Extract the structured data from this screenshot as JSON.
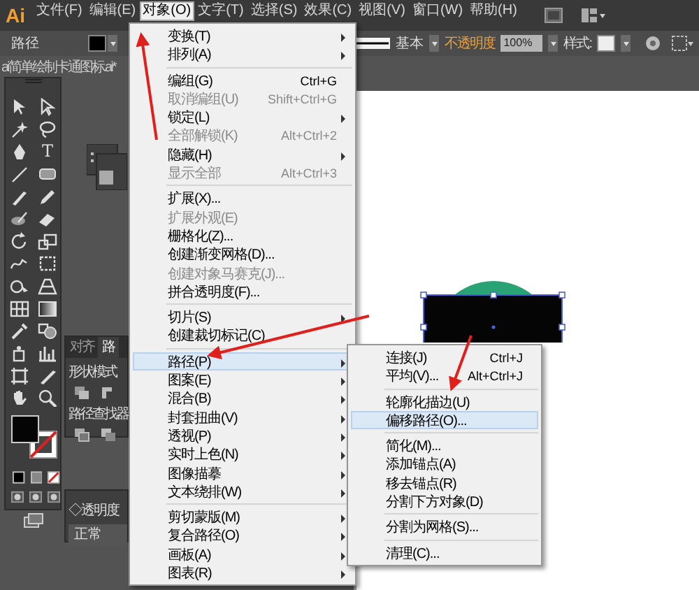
{
  "menubar": {
    "logo": "Ai",
    "items": [
      {
        "label": "文件(F)",
        "selected": false
      },
      {
        "label": "编辑(E)",
        "selected": false
      },
      {
        "label": "对象(O)",
        "selected": true
      },
      {
        "label": "文字(T)",
        "selected": false
      },
      {
        "label": "选择(S)",
        "selected": false
      },
      {
        "label": "效果(C)",
        "selected": false
      },
      {
        "label": "视图(V)",
        "selected": false
      },
      {
        "label": "窗口(W)",
        "selected": false
      },
      {
        "label": "帮助(H)",
        "selected": false
      }
    ]
  },
  "control_bar": {
    "object_type": "路径",
    "stroke_profile": "基本",
    "opacity_label": "不透明度",
    "opacity_value": "100%",
    "style_label": "样式:"
  },
  "document_tab": {
    "title": "ai简单绘制卡通图标.ai*"
  },
  "toolbar": {
    "type_tool": "T"
  },
  "pathfinder_panel": {
    "tabs": [
      {
        "label": "对齐",
        "selected": false
      },
      {
        "label": "路",
        "selected": true
      }
    ],
    "shape_modes_label": "形状模式",
    "pathfinders_label": "路径查找器"
  },
  "transparency_panel": {
    "title": "◇透明度",
    "blend_mode": "正常"
  },
  "object_menu": {
    "items": [
      {
        "kind": "item",
        "label": "变换(T)",
        "submenu": true,
        "disabled": false,
        "selected": false
      },
      {
        "kind": "item",
        "label": "排列(A)",
        "submenu": true,
        "disabled": false,
        "selected": false
      },
      {
        "kind": "separator"
      },
      {
        "kind": "item",
        "label": "编组(G)",
        "shortcut": "Ctrl+G",
        "submenu": false,
        "disabled": false,
        "selected": false
      },
      {
        "kind": "item",
        "label": "取消编组(U)",
        "shortcut": "Shift+Ctrl+G",
        "submenu": false,
        "disabled": true,
        "selected": false
      },
      {
        "kind": "item",
        "label": "锁定(L)",
        "submenu": true,
        "disabled": false,
        "selected": false
      },
      {
        "kind": "item",
        "label": "全部解锁(K)",
        "shortcut": "Alt+Ctrl+2",
        "submenu": false,
        "disabled": true,
        "selected": false
      },
      {
        "kind": "item",
        "label": "隐藏(H)",
        "submenu": true,
        "disabled": false,
        "selected": false
      },
      {
        "kind": "item",
        "label": "显示全部",
        "shortcut": "Alt+Ctrl+3",
        "submenu": false,
        "disabled": true,
        "selected": false
      },
      {
        "kind": "separator"
      },
      {
        "kind": "item",
        "label": "扩展(X)...",
        "submenu": false,
        "disabled": false,
        "selected": false
      },
      {
        "kind": "item",
        "label": "扩展外观(E)",
        "submenu": false,
        "disabled": true,
        "selected": false
      },
      {
        "kind": "item",
        "label": "栅格化(Z)...",
        "submenu": false,
        "disabled": false,
        "selected": false
      },
      {
        "kind": "item",
        "label": "创建渐变网格(D)...",
        "submenu": false,
        "disabled": false,
        "selected": false
      },
      {
        "kind": "item",
        "label": "创建对象马赛克(J)...",
        "submenu": false,
        "disabled": true,
        "selected": false
      },
      {
        "kind": "item",
        "label": "拼合透明度(F)...",
        "submenu": false,
        "disabled": false,
        "selected": false
      },
      {
        "kind": "separator"
      },
      {
        "kind": "item",
        "label": "切片(S)",
        "submenu": true,
        "disabled": false,
        "selected": false
      },
      {
        "kind": "item",
        "label": "创建裁切标记(C)",
        "submenu": false,
        "disabled": false,
        "selected": false
      },
      {
        "kind": "separator"
      },
      {
        "kind": "item",
        "label": "路径(P)",
        "submenu": true,
        "disabled": false,
        "selected": true
      },
      {
        "kind": "item",
        "label": "图案(E)",
        "submenu": true,
        "disabled": false,
        "selected": false
      },
      {
        "kind": "item",
        "label": "混合(B)",
        "submenu": true,
        "disabled": false,
        "selected": false
      },
      {
        "kind": "item",
        "label": "封套扭曲(V)",
        "submenu": true,
        "disabled": false,
        "selected": false
      },
      {
        "kind": "item",
        "label": "透视(P)",
        "submenu": true,
        "disabled": false,
        "selected": false
      },
      {
        "kind": "item",
        "label": "实时上色(N)",
        "submenu": true,
        "disabled": false,
        "selected": false
      },
      {
        "kind": "item",
        "label": "图像描摹",
        "submenu": true,
        "disabled": false,
        "selected": false
      },
      {
        "kind": "item",
        "label": "文本绕排(W)",
        "submenu": true,
        "disabled": false,
        "selected": false
      },
      {
        "kind": "separator"
      },
      {
        "kind": "item",
        "label": "剪切蒙版(M)",
        "submenu": true,
        "disabled": false,
        "selected": false
      },
      {
        "kind": "item",
        "label": "复合路径(O)",
        "submenu": true,
        "disabled": false,
        "selected": false
      },
      {
        "kind": "item",
        "label": "画板(A)",
        "submenu": true,
        "disabled": false,
        "selected": false
      },
      {
        "kind": "item",
        "label": "图表(R)",
        "submenu": true,
        "disabled": false,
        "selected": false
      }
    ]
  },
  "path_submenu": {
    "items": [
      {
        "kind": "item",
        "label": "连接(J)",
        "shortcut": "Ctrl+J",
        "submenu": false,
        "disabled": false,
        "selected": false
      },
      {
        "kind": "item",
        "label": "平均(V)...",
        "shortcut": "Alt+Ctrl+J",
        "submenu": false,
        "disabled": false,
        "selected": false
      },
      {
        "kind": "separator"
      },
      {
        "kind": "item",
        "label": "轮廓化描边(U)",
        "submenu": false,
        "disabled": false,
        "selected": false
      },
      {
        "kind": "item",
        "label": "偏移路径(O)...",
        "submenu": false,
        "disabled": false,
        "selected": true
      },
      {
        "kind": "separator"
      },
      {
        "kind": "item",
        "label": "简化(M)...",
        "submenu": false,
        "disabled": false,
        "selected": false
      },
      {
        "kind": "item",
        "label": "添加锚点(A)",
        "submenu": false,
        "disabled": false,
        "selected": false
      },
      {
        "kind": "item",
        "label": "移去锚点(R)",
        "submenu": false,
        "disabled": false,
        "selected": false
      },
      {
        "kind": "item",
        "label": "分割下方对象(D)",
        "submenu": false,
        "disabled": false,
        "selected": false
      },
      {
        "kind": "separator"
      },
      {
        "kind": "item",
        "label": "分割为网格(S)...",
        "submenu": false,
        "disabled": false,
        "selected": false
      },
      {
        "kind": "separator"
      },
      {
        "kind": "item",
        "label": "清理(C)...",
        "submenu": false,
        "disabled": false,
        "selected": false
      }
    ]
  }
}
